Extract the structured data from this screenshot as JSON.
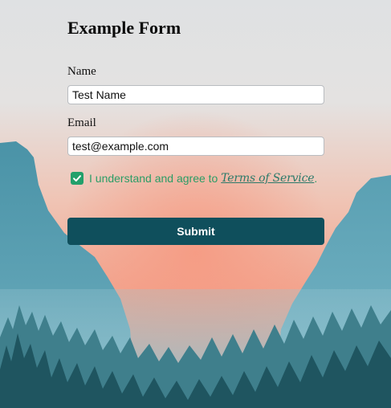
{
  "form": {
    "title": "Example Form",
    "name_label": "Name",
    "name_value": "Test Name",
    "email_label": "Email",
    "email_value": "test@example.com",
    "consent_text": "I understand and agree to ",
    "consent_link": "Terms of Service",
    "consent_end": ".",
    "consent_checked": true,
    "submit_label": "Submit"
  },
  "icons": {
    "checkbox": "check-icon"
  },
  "colors": {
    "submit_button": "#0f4f5c",
    "checkbox": "#22a06b",
    "consent_text": "#2a9d66"
  }
}
